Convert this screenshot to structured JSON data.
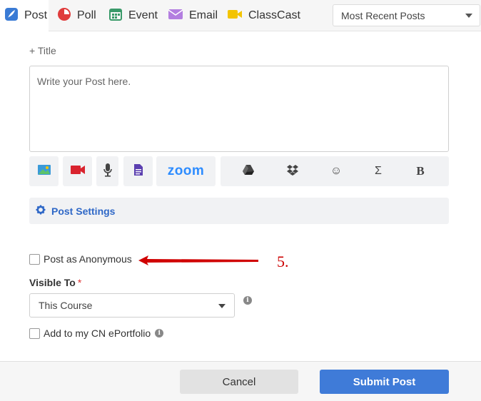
{
  "tabs": [
    {
      "label": "Post",
      "icon": "feather-pen-icon",
      "color": "#3a7bd5"
    },
    {
      "label": "Poll",
      "icon": "pie-chart-icon",
      "color": "#e03c3c"
    },
    {
      "label": "Event",
      "icon": "calendar-icon",
      "color": "#3a9a6a"
    },
    {
      "label": "Email",
      "icon": "envelope-icon",
      "color": "#b37ee0"
    },
    {
      "label": "ClassCast",
      "icon": "video-camera-icon",
      "color": "#f3c400"
    }
  ],
  "sort": {
    "selected": "Most Recent Posts"
  },
  "composer": {
    "title_link": "+ Title",
    "placeholder": "Write your Post here.",
    "toolbar": {
      "zoom_label": "zoom",
      "sigma": "Σ",
      "bold": "B",
      "smiley": "☺"
    }
  },
  "settings": {
    "label": "Post Settings"
  },
  "anonymous": {
    "label": "Post as Anonymous"
  },
  "annotation": {
    "label": "5."
  },
  "visibility": {
    "label": "Visible To",
    "required_mark": "*",
    "selected": "This Course"
  },
  "eportfolio": {
    "label": "Add to my CN ePortfolio"
  },
  "footer": {
    "cancel": "Cancel",
    "submit": "Submit Post"
  },
  "colors": {
    "accent": "#3f7bd8",
    "link": "#2f68c7",
    "annotation": "#d00000"
  }
}
